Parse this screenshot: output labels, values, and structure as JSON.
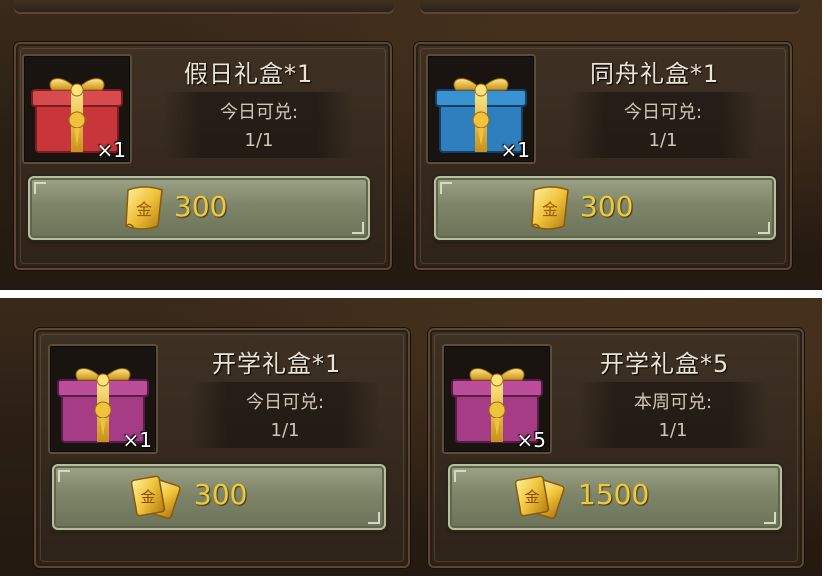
{
  "items": [
    {
      "title": "假日礼盒*1",
      "limit_label": "今日可兑:",
      "limit_count": "1/1",
      "quantity": "×1",
      "price": "300",
      "currency_icon": "gold-scroll-icon",
      "box_color": "#c8363a"
    },
    {
      "title": "同舟礼盒*1",
      "limit_label": "今日可兑:",
      "limit_count": "1/1",
      "quantity": "×1",
      "price": "300",
      "currency_icon": "gold-scroll-icon",
      "box_color": "#2f7fbe"
    },
    {
      "title": "开学礼盒*1",
      "limit_label": "今日可兑:",
      "limit_count": "1/1",
      "quantity": "×1",
      "price": "300",
      "currency_icon": "gold-ticket-icon",
      "box_color": "#a63b86"
    },
    {
      "title": "开学礼盒*5",
      "limit_label": "本周可兑:",
      "limit_count": "1/1",
      "quantity": "×5",
      "price": "1500",
      "currency_icon": "gold-ticket-icon",
      "box_color": "#a63b86"
    }
  ],
  "colors": {
    "price_gold": "#f3c933",
    "button_green": "#7e8569",
    "panel_brown": "#2b1f15"
  }
}
